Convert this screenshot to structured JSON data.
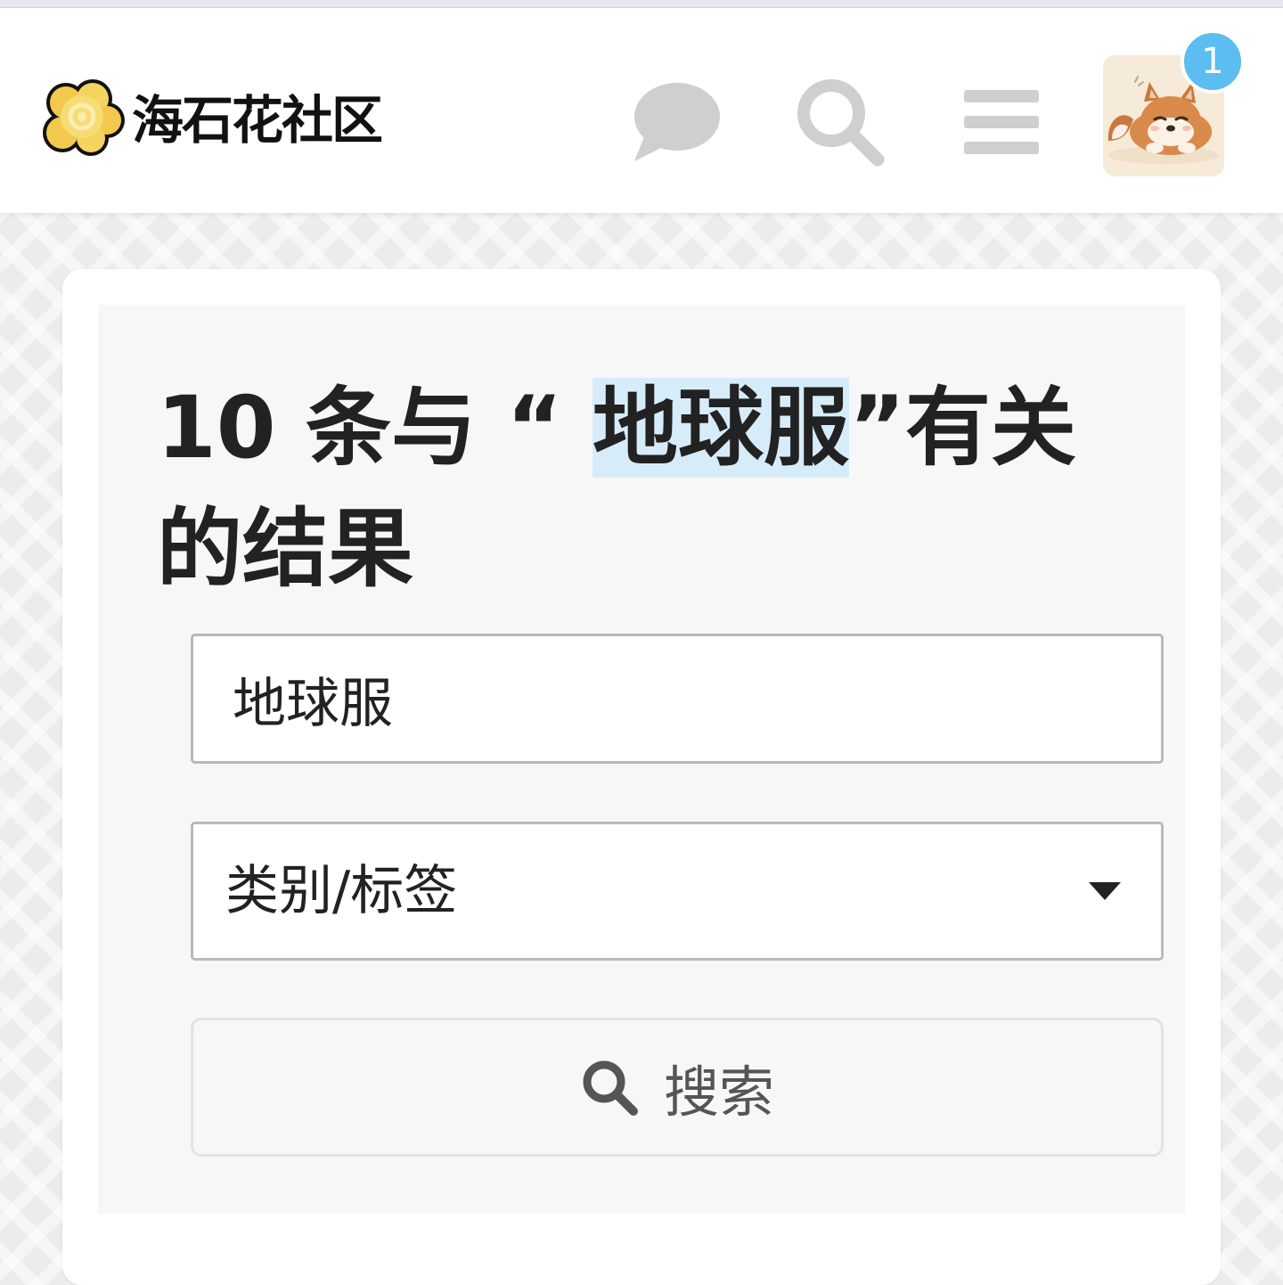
{
  "header": {
    "logo_text": "海石花社区",
    "icons": [
      "chat-icon",
      "search-icon",
      "menu-icon"
    ],
    "notification_count": "1",
    "badge_color": "#5bbdf0",
    "icon_color": "#cfcfcf"
  },
  "search_results": {
    "title_prefix": "10 条与 “ ",
    "title_term": "地球服",
    "title_suffix": "”有关的结果",
    "query_value": "地球服",
    "category_select": "类别/标签",
    "search_button_label": "搜索",
    "highlight_color": "#d6edf9"
  }
}
